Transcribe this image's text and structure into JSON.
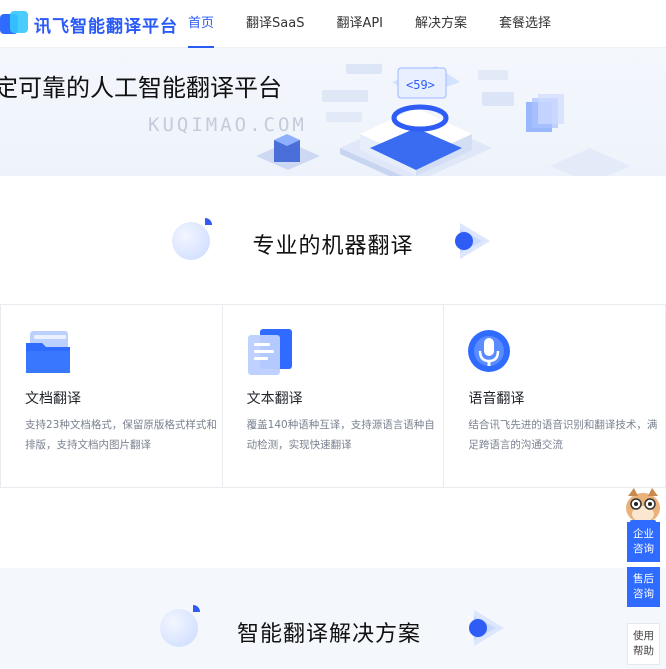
{
  "brand": {
    "name": "讯飞智能翻译平台"
  },
  "nav": [
    {
      "label": "首页",
      "active": true
    },
    {
      "label": "翻译SaaS",
      "active": false
    },
    {
      "label": "翻译API",
      "active": false
    },
    {
      "label": "解决方案",
      "active": false
    },
    {
      "label": "套餐选择",
      "active": false
    }
  ],
  "banner": {
    "title": "定可靠的人工智能翻译平台",
    "watermark": "KUQIMAO.COM"
  },
  "section_machine": {
    "title": "专业的机器翻译"
  },
  "cards": [
    {
      "title": "文档翻译",
      "desc": "支持23种文档格式，保留原版格式样式和排版，支持文档内图片翻译",
      "icon": "document-folder-icon"
    },
    {
      "title": "文本翻译",
      "desc": "覆盖140种语种互译，支持源语言语种自动检测，实现快速翻译",
      "icon": "text-pages-icon"
    },
    {
      "title": "语音翻译",
      "desc": "结合讯飞先进的语音识别和翻译技术，满足跨语言的沟通交流",
      "icon": "microphone-icon"
    }
  ],
  "section_solution": {
    "title": "智能翻译解决方案"
  },
  "float": {
    "enterprise": "企业\n咨询",
    "aftersale": "售后\n咨询",
    "help": "使用\n帮助"
  },
  "colors": {
    "accent": "#2a5bf6",
    "float_blue": "#2f6bff"
  }
}
